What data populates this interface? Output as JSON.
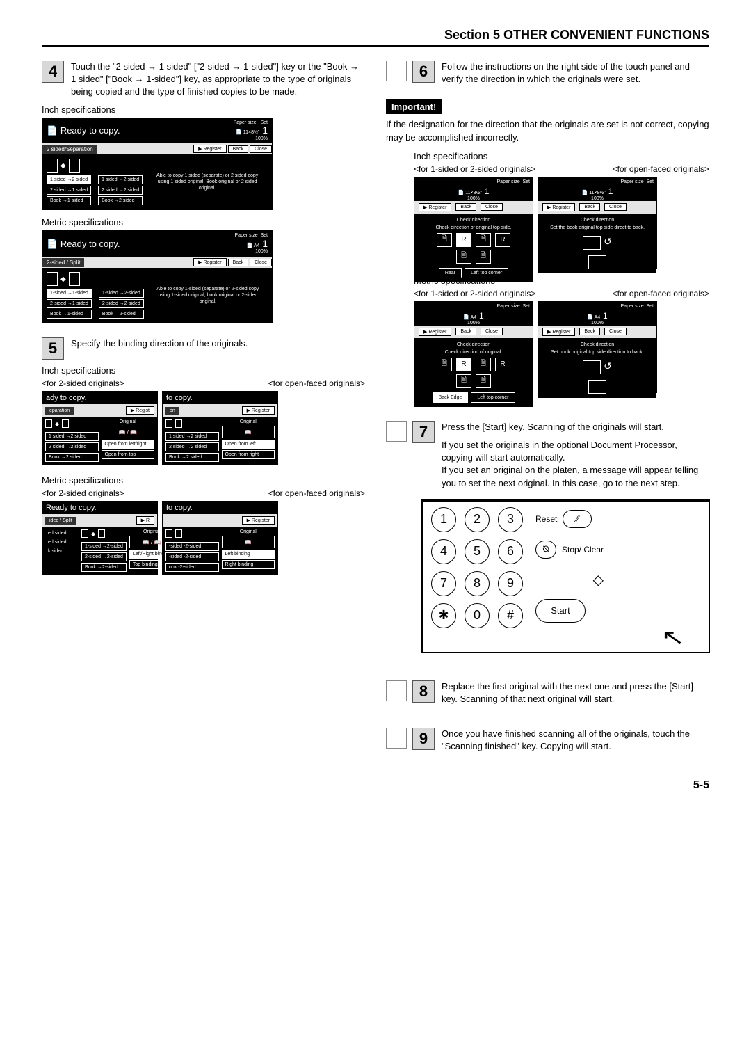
{
  "header": "Section 5  OTHER CONVENIENT FUNCTIONS",
  "page_number": "5-5",
  "steps": {
    "4": {
      "num": "4",
      "text": "Touch the \"2 sided → 1 sided\" [\"2-sided → 1-sided\"] key or the \"Book → 1 sided\" [\"Book → 1-sided\"] key, as appropriate to the type of originals being copied and the type of finished copies to be made."
    },
    "5": {
      "num": "5",
      "text": "Specify the binding direction of the originals."
    },
    "6": {
      "num": "6",
      "text": "Follow the instructions on the right side of the touch panel and verify the direction in which the originals were set."
    },
    "7": {
      "num": "7",
      "text": "Press the [Start] key. Scanning of the originals will start.",
      "text2": "If you set the originals in the optional Document Processor, copying will start automatically.",
      "text3": "If you set an original on the platen, a message will appear telling you to set the next original. In this case, go to the next step."
    },
    "8": {
      "num": "8",
      "text": "Replace the first original with the next one and press the [Start] key. Scanning of that next original will start."
    },
    "9": {
      "num": "9",
      "text": "Once you have finished scanning all of the originals, touch the \"Scanning finished\" key. Copying will start."
    }
  },
  "labels": {
    "inch_spec": "Inch specifications",
    "metric_spec": "Metric specifications",
    "for_2sided": "<for 2-sided originals>",
    "for_open": "<for open-faced originals>",
    "for_1or2": "<for 1-sided or 2-sided originals>",
    "important": "Important!",
    "important_text": "If the designation for the direction that the originals are set is not correct, copying may be accomplished incorrectly."
  },
  "panel_inch": {
    "title": "Ready to copy.",
    "paper_size": "Paper size",
    "size": "11×8½\"",
    "pct": "100%",
    "set": "Set",
    "count": "1",
    "tab": "2 sided/Separation",
    "register": "Register",
    "back": "Back",
    "close": "Close",
    "body_text": "Able to copy 1 sided (separate) or 2 sided copy using 1 sided original, Book original or 2 sided original.",
    "col1": [
      "1 sided →2 sided",
      "2 sided →1 sided",
      "Book →1 sided"
    ],
    "col2": [
      "1 sided →2 sided",
      "2 sided →2 sided",
      "Book →2 sided"
    ]
  },
  "panel_metric": {
    "title": "Ready to copy.",
    "size_icons": "A4",
    "pct": "100%",
    "set": "Set",
    "count": "1",
    "tab": "2-sided / Split",
    "register": "Register",
    "back": "Back",
    "close": "Close",
    "body_text": "Able to copy 1-sided (separate) or 2-sided copy using 1-sided original, book original or 2-sided original.",
    "col1": [
      "1-sided →1-sided",
      "2-sided →1-sided",
      "Book →1-sided"
    ],
    "col2": [
      "1-sided →2-sided",
      "2-sided →2-sided",
      "Book →2-sided"
    ]
  },
  "step5_panels": {
    "inch_2sided": {
      "title": "ady to copy.",
      "tab": "eparation",
      "register": "Regist",
      "orig": "Original",
      "col1": [
        "1 sided →2 sided",
        "2 sided →2 sided",
        "Book →2 sided"
      ],
      "col2": [
        "Open from left/right",
        "Open from top"
      ]
    },
    "inch_open": {
      "title": "to copy.",
      "tab": "on",
      "register": "Register",
      "orig": "Original",
      "col1": [
        "1 sided →2 sided",
        "2 sided →2 sided",
        "Book →2 sided"
      ],
      "col2": [
        "Open from left",
        "Open from right"
      ]
    },
    "metric_2sided": {
      "title": "Ready to copy.",
      "tab": "ided / Split",
      "register": "R",
      "orig": "Original",
      "col1": [
        "ed sided",
        "ed sided",
        "k sided"
      ],
      "col1b": [
        "1-sided →2-sided",
        "2-sided →2-sided",
        "Book →2-sided"
      ],
      "col2": [
        "Left/Right binding",
        "Top binding"
      ]
    },
    "metric_open": {
      "title": "to copy.",
      "register": "Register",
      "orig": "Original",
      "col1": [
        "-sided -2-sided",
        "-sided -2-sided",
        "ook -2-sided"
      ],
      "col2": [
        "Left binding",
        "Right binding"
      ]
    }
  },
  "dir_inch": {
    "paper_size": "Paper size",
    "size": "11×8½\"",
    "pct": "100%",
    "set": "Set",
    "count": "1",
    "register": "Register",
    "back": "Back",
    "close": "Close",
    "left": {
      "title": "Check direction",
      "sub": "Check direction of original top side.",
      "btn1": "Rear",
      "btn2": "Left top corner"
    },
    "right": {
      "title": "Check direction",
      "sub": "Set the book original top side direct to back."
    }
  },
  "dir_metric": {
    "size_icons": "A4",
    "pct": "100%",
    "set": "Set",
    "count": "1",
    "register": "Register",
    "back": "Back",
    "close": "Close",
    "left": {
      "title": "Check direction",
      "sub": "Check direction of original.",
      "btn1": "Back Edge",
      "btn2": "Left top corner"
    },
    "right": {
      "title": "Check direction",
      "sub": "Set book original top side direction to back."
    }
  },
  "keypad": {
    "reset": "Reset",
    "stop": "Stop/ Clear",
    "start": "Start",
    "keys": [
      "1",
      "2",
      "3",
      "4",
      "5",
      "6",
      "7",
      "8",
      "9",
      "✱",
      "0",
      "#"
    ],
    "stop_sym": "⦰",
    "diamond": "◇"
  }
}
